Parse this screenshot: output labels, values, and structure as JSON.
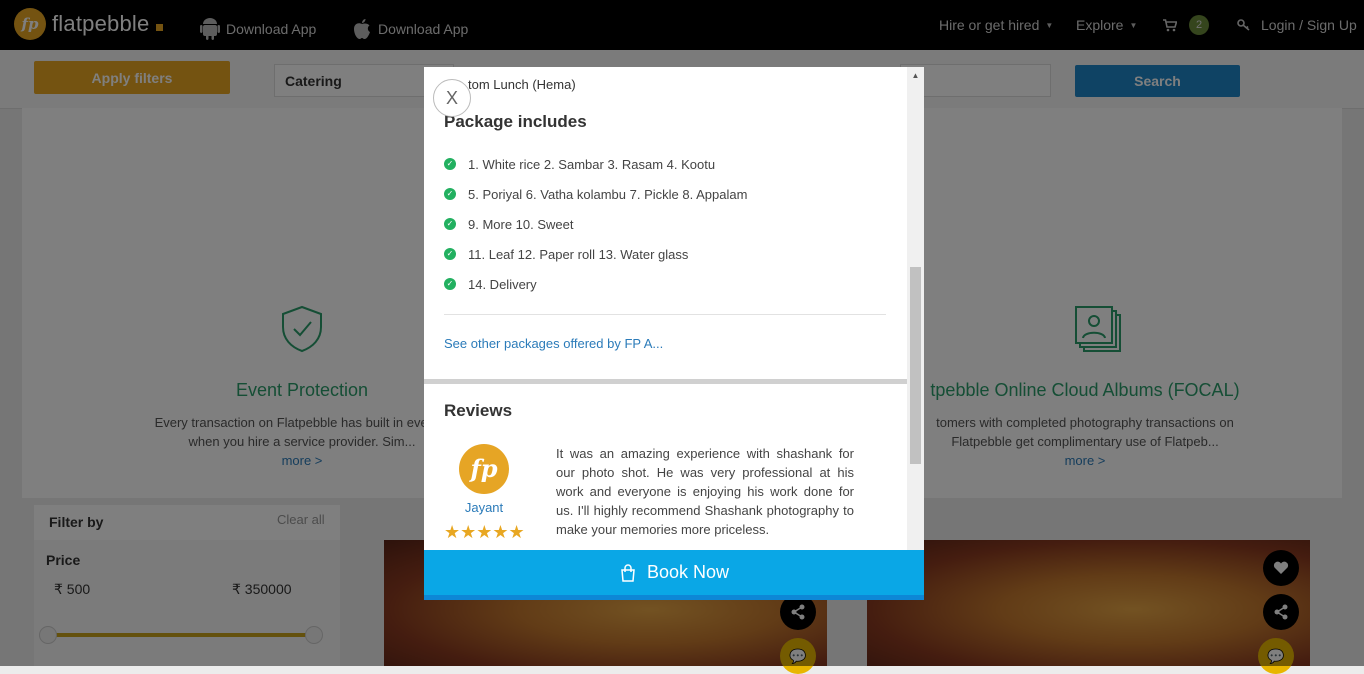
{
  "header": {
    "logo_mark": "fp",
    "logo_text": "flatpebble",
    "download_android": "Download App",
    "download_ios": "Download App",
    "hire_menu": "Hire or get hired",
    "explore_menu": "Explore",
    "cart_count": "2",
    "login": "Login / Sign Up"
  },
  "filterbar": {
    "apply_filters": "Apply filters",
    "category": "Catering",
    "search": "Search"
  },
  "features": [
    {
      "title": "Event Protection",
      "desc1": "Every transaction on Flatpebble has built in event p",
      "desc2": "when you hire a service provider. Sim...",
      "more": "more >"
    },
    {
      "title": "tpebble Online Cloud Albums (FOCAL)",
      "desc1": "tomers with completed photography transactions on",
      "desc2": "Flatpebble get complimentary use of Flatpeb...",
      "more": "more >"
    }
  ],
  "filters": {
    "title": "Filter by",
    "clear_all": "Clear all",
    "price_label": "Price",
    "price_min": "₹ 500",
    "price_max": "₹ 350000"
  },
  "modal": {
    "close": "X",
    "package_name": "tom Lunch (Hema)",
    "includes_title": "Package includes",
    "includes": [
      "1. White rice 2. Sambar 3. Rasam 4. Kootu",
      "5. Poriyal 6. Vatha kolambu 7. Pickle 8. Appalam",
      "9. More 10. Sweet",
      "11. Leaf 12. Paper roll 13. Water glass",
      "14. Delivery"
    ],
    "other_packages": "See other packages offered by FP A...",
    "reviews_title": "Reviews",
    "review": {
      "avatar": "fp",
      "name": "Jayant",
      "stars": 5,
      "stars_text": "★★★★★",
      "text": "It was an amazing experience with shashank for our photo shot. He was very professional at his work and everyone is enjoying his work done for us. I'll highly recommend Shashank photography to make your memories more priceless."
    },
    "book_now": "Book Now"
  },
  "colors": {
    "brand": "#e8a722",
    "accent_blue": "#0aa7e6",
    "search_blue": "#1e86c9",
    "green": "#2a9d6a"
  },
  "icons": [
    "android-icon",
    "apple-icon",
    "cart-icon",
    "key-icon",
    "shield-check-icon",
    "photo-album-icon",
    "check-icon",
    "shopping-bag-icon",
    "heart-icon",
    "share-icon",
    "chat-icon",
    "close-icon"
  ]
}
